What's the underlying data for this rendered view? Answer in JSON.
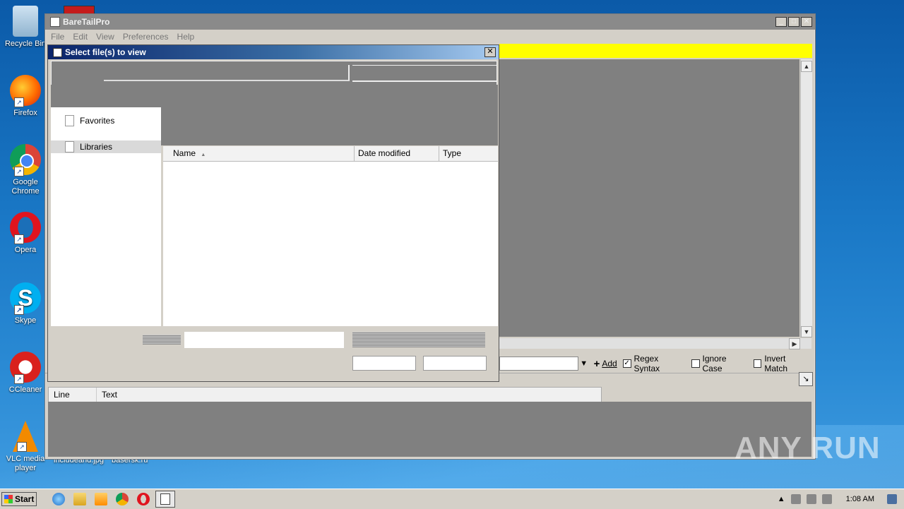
{
  "desktop": {
    "icons": [
      {
        "label": "Recycle Bin",
        "icon": "recycle-bin-icon"
      },
      {
        "label": "Firefox",
        "icon": "firefox-icon"
      },
      {
        "label": "Google Chrome",
        "icon": "chrome-icon"
      },
      {
        "label": "Opera",
        "icon": "opera-icon"
      },
      {
        "label": "Skype",
        "icon": "skype-icon"
      },
      {
        "label": "CCleaner",
        "icon": "ccleaner-icon"
      },
      {
        "label": "VLC media player",
        "icon": "vlc-icon"
      }
    ],
    "partial_captions": [
      "includeand.jpg",
      "basersk.ru"
    ]
  },
  "main_window": {
    "title": "BareTailPro",
    "menu": [
      "File",
      "Edit",
      "View",
      "Preferences",
      "Help"
    ],
    "highlight_color": "#ffff00",
    "filter_bar": {
      "add_label": "Add",
      "regex_label": "Regex Syntax",
      "regex_checked": true,
      "ignore_case_label": "Ignore Case",
      "ignore_case_checked": false,
      "invert_match_label": "Invert Match",
      "invert_match_checked": false
    },
    "results_columns": [
      "Line",
      "Text"
    ]
  },
  "dialog": {
    "title": "Select file(s) to view",
    "close_glyph": "✕",
    "nav_items": [
      {
        "label": "Favorites",
        "selected": false
      },
      {
        "label": "Libraries",
        "selected": true
      }
    ],
    "columns": [
      {
        "label": "Name",
        "sorted": true
      },
      {
        "label": "Date modified"
      },
      {
        "label": "Type"
      }
    ]
  },
  "taskbar": {
    "start_label": "Start",
    "pinned": [
      "ie-icon",
      "explorer-icon",
      "media-player-icon",
      "chrome-icon",
      "opera-icon"
    ],
    "active": "baretailpro-icon",
    "clock": "1:08 AM"
  },
  "watermark": "ANY RUN"
}
